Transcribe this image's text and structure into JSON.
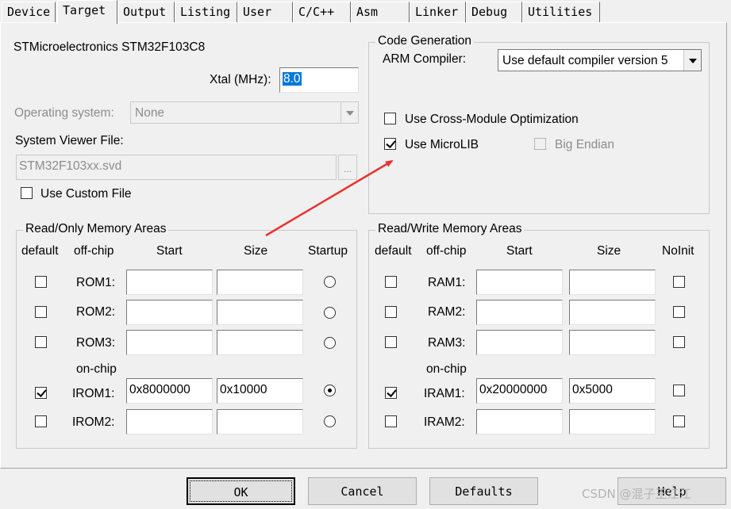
{
  "tabs": [
    "Device",
    "Target",
    "Output",
    "Listing",
    "User",
    "C/C++",
    "Asm",
    "Linker",
    "Debug",
    "Utilities"
  ],
  "device": {
    "name": "STMicroelectronics STM32F103C8",
    "xtal_label": "Xtal (MHz):",
    "xtal_value": "8.0",
    "os_label": "Operating system:",
    "os_value": "None",
    "svf_label": "System Viewer File:",
    "svf_value": "STM32F103xx.svd",
    "browse_label": "...",
    "custom_file_label": "Use Custom File"
  },
  "code_gen": {
    "title": "Code Generation",
    "compiler_label": "ARM Compiler:",
    "compiler_value": "Use default compiler version 5",
    "cross_module_label": "Use Cross-Module Optimization",
    "microlib_label": "Use MicroLIB",
    "big_endian_label": "Big Endian"
  },
  "ro_memory": {
    "title": "Read/Only Memory Areas",
    "headers": {
      "default": "default",
      "offchip": "off-chip",
      "start": "Start",
      "size": "Size",
      "startup": "Startup"
    },
    "onchip_label": "on-chip",
    "rows": [
      {
        "label": "ROM1:",
        "start": "",
        "size": ""
      },
      {
        "label": "ROM2:",
        "start": "",
        "size": ""
      },
      {
        "label": "ROM3:",
        "start": "",
        "size": ""
      },
      {
        "label": "IROM1:",
        "start": "0x8000000",
        "size": "0x10000"
      },
      {
        "label": "IROM2:",
        "start": "",
        "size": ""
      }
    ]
  },
  "rw_memory": {
    "title": "Read/Write Memory Areas",
    "headers": {
      "default": "default",
      "offchip": "off-chip",
      "start": "Start",
      "size": "Size",
      "noinit": "NoInit"
    },
    "onchip_label": "on-chip",
    "rows": [
      {
        "label": "RAM1:",
        "start": "",
        "size": ""
      },
      {
        "label": "RAM2:",
        "start": "",
        "size": ""
      },
      {
        "label": "RAM3:",
        "start": "",
        "size": ""
      },
      {
        "label": "IRAM1:",
        "start": "0x20000000",
        "size": "0x5000"
      },
      {
        "label": "IRAM2:",
        "start": "",
        "size": ""
      }
    ]
  },
  "buttons": {
    "ok": "OK",
    "cancel": "Cancel",
    "defaults": "Defaults",
    "help": "Help"
  },
  "watermark": "CSDN @混子王江江",
  "colors": {
    "arrow": "#e8332e",
    "selection": "#0078d7"
  }
}
